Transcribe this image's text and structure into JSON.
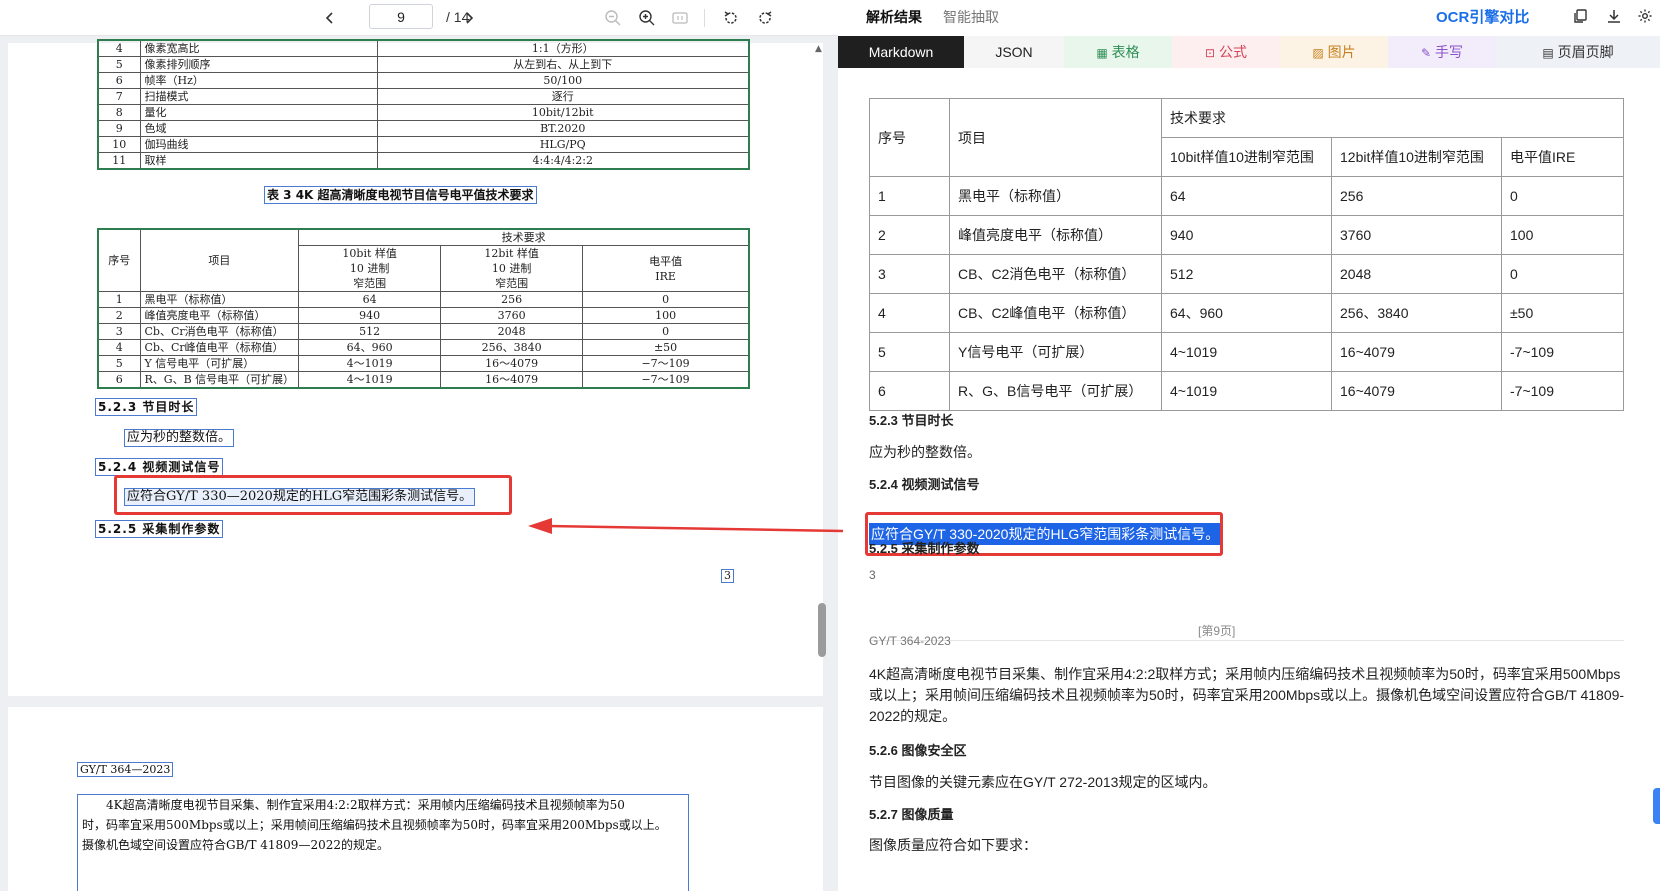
{
  "viewer": {
    "current_page": "9",
    "total_pages": "/ 14"
  },
  "specs_rows": [
    [
      "4",
      "像素宽高比",
      "1:1（方形）"
    ],
    [
      "5",
      "像素排列顺序",
      "从左到右、从上到下"
    ],
    [
      "6",
      "帧率（Hz）",
      "50/100"
    ],
    [
      "7",
      "扫描模式",
      "逐行"
    ],
    [
      "8",
      "量化",
      "10bit/12bit"
    ],
    [
      "9",
      "色域",
      "BT.2020"
    ],
    [
      "10",
      "伽玛曲线",
      "HLG/PQ"
    ],
    [
      "11",
      "取样",
      "4:4:4/4:2:2"
    ]
  ],
  "table3": {
    "caption": "表 3  4K 超高清晰度电视节目信号电平值技术要求",
    "h_index": "序号",
    "h_item": "项目",
    "h_req": "技术要求",
    "h_10bit": [
      "10bit 样值",
      "10 进制",
      "窄范围"
    ],
    "h_12bit": [
      "12bit 样值",
      "10 进制",
      "窄范围"
    ],
    "h_ire": [
      "电平值",
      "IRE"
    ],
    "rows": [
      [
        "1",
        "黑电平（标称值）",
        "64",
        "256",
        "0"
      ],
      [
        "2",
        "峰值亮度电平（标称值）",
        "940",
        "3760",
        "100"
      ],
      [
        "3",
        "Cb、Cr消色电平（标称值）",
        "512",
        "2048",
        "0"
      ],
      [
        "4",
        "Cb、Cr峰值电平（标称值）",
        "64、960",
        "256、3840",
        "±50"
      ],
      [
        "5",
        "Y 信号电平（可扩展）",
        "4～1019",
        "16～4079",
        "−7～109"
      ],
      [
        "6",
        "R、G、B 信号电平（可扩展）",
        "4～1019",
        "16～4079",
        "−7～109"
      ]
    ]
  },
  "pdf_text": {
    "s523": "5.2.3  节目时长",
    "s523_body": "应为秒的整数倍。",
    "s524": "5.2.4  视频测试信号",
    "s524_body": "应符合GY/T 330—2020规定的HLG窄范围彩条测试信号。",
    "s525": "5.2.5  采集制作参数",
    "page_number": "3",
    "p2_header": "GY/T 364—2023",
    "p2_line1": "4K超高清晰度电视节目采集、制作宜采用4:2:2取样方式：采用帧内压缩编码技术且视频帧率为50",
    "p2_line2": "时，码率宜采用500Mbps或以上；采用帧间压缩编码技术且视频帧率为50时，码率宜采用200Mbps或以上。",
    "p2_line3": "摄像机色域空间设置应符合GB/T 41809—2022的规定。"
  },
  "right_header": {
    "tab_parse": "解析结果",
    "tab_extract": "智能抽取",
    "ocr_compare": "OCR引擎对比"
  },
  "format_tabs": [
    {
      "label": "Markdown",
      "icon": ""
    },
    {
      "label": "JSON",
      "icon": ""
    },
    {
      "label": "表格",
      "icon": "table-icon"
    },
    {
      "label": "公式",
      "icon": "formula-icon"
    },
    {
      "label": "图片",
      "icon": "image-icon"
    },
    {
      "label": "手写",
      "icon": "handwriting-icon"
    },
    {
      "label": "页眉页脚",
      "icon": "header-footer-icon"
    }
  ],
  "colors": {
    "tab_active_bg": "#1f1f1f",
    "tab_json_bg": "#f5f5f5",
    "tab_table_bg": "#e8f6ec",
    "tab_formula_bg": "#fdeef0",
    "tab_image_bg": "#fdf3e4",
    "tab_handwriting_bg": "#f3ecfb",
    "tab_headerfooter_bg": "#eef1f6",
    "accent": "#1a6fe8",
    "highlight": "#e53935"
  },
  "md_table": {
    "h_index": "序号",
    "h_item": "项目",
    "h_req": "技术要求",
    "h_10bit": "10bit样值10进制窄范围",
    "h_12bit": "12bit样值10进制窄范围",
    "h_ire": "电平值IRE",
    "rows": [
      [
        "1",
        "黑电平（标称值）",
        "64",
        "256",
        "0"
      ],
      [
        "2",
        "峰值亮度电平（标称值）",
        "940",
        "3760",
        "100"
      ],
      [
        "3",
        "CB、C2消色电平（标称值）",
        "512",
        "2048",
        "0"
      ],
      [
        "4",
        "CB、C2峰值电平（标称值）",
        "64、960",
        "256、3840",
        "±50"
      ],
      [
        "5",
        "Y信号电平（可扩展）",
        "4~1019",
        "16~4079",
        "-7~109"
      ],
      [
        "6",
        "R、G、B信号电平（可扩展）",
        "4~1019",
        "16~4079",
        "-7~109"
      ]
    ]
  },
  "md_text": {
    "s523": "5.2.3 节目时长",
    "s523_body": "应为秒的整数倍。",
    "s524": "5.2.4 视频测试信号",
    "s524_body": "应符合GY/T 330-2020规定的HLG窄范围彩条测试信号。",
    "s525": "5.2.5 采集制作参数",
    "page_number": "3",
    "page_marker": "[第9页]",
    "doc_header": "GY/T 364-2023",
    "para_line1": "4K超高清晰度电视节目采集、制作宜采用4:2:2取样方式；采用帧内压缩编码技术且视频帧率为50时，码率宜采用500Mbps",
    "para_line2": "或以上；采用帧间压缩编码技术且视频帧率为50时，码率宜采用200Mbps或以上。摄像机色域空间设置应符合GB/T 41809-",
    "para_line3": "2022的规定。",
    "s526": "5.2.6 图像安全区",
    "s526_body": "节目图像的关键元素应在GY/T 272-2013规定的区域内。",
    "s527": "5.2.7 图像质量",
    "s527_body": "图像质量应符合如下要求："
  }
}
